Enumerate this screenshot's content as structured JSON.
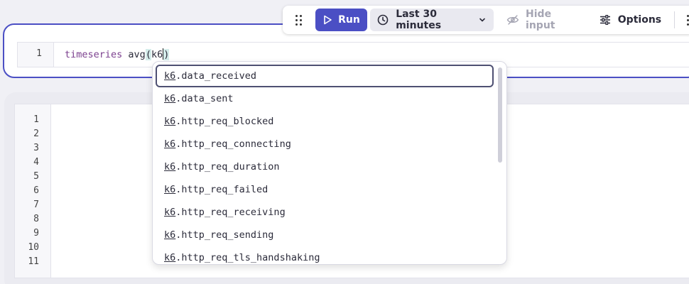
{
  "toolbar": {
    "run_label": "Run",
    "timeframe_label": "Last 30 minutes",
    "hide_input_label": "Hide input",
    "options_label": "Options"
  },
  "query_editor": {
    "line_number": "1",
    "code": {
      "keyword": "timeseries",
      "function": "avg",
      "open_paren": "(",
      "argument": "k6",
      "close_paren": ")"
    }
  },
  "autocomplete": {
    "typed": "k6",
    "suggestions": [
      {
        "prefix": "k6",
        "rest": ".data_received"
      },
      {
        "prefix": "k6",
        "rest": ".data_sent"
      },
      {
        "prefix": "k6",
        "rest": ".http_req_blocked"
      },
      {
        "prefix": "k6",
        "rest": ".http_req_connecting"
      },
      {
        "prefix": "k6",
        "rest": ".http_req_duration"
      },
      {
        "prefix": "k6",
        "rest": ".http_req_failed"
      },
      {
        "prefix": "k6",
        "rest": ".http_req_receiving"
      },
      {
        "prefix": "k6",
        "rest": ".http_req_sending"
      },
      {
        "prefix": "k6",
        "rest": ".http_req_tls_handshaking"
      }
    ]
  },
  "second_editor": {
    "line_numbers": [
      "1",
      "2",
      "3",
      "4",
      "5",
      "6",
      "7",
      "8",
      "9",
      "10",
      "11"
    ]
  }
}
